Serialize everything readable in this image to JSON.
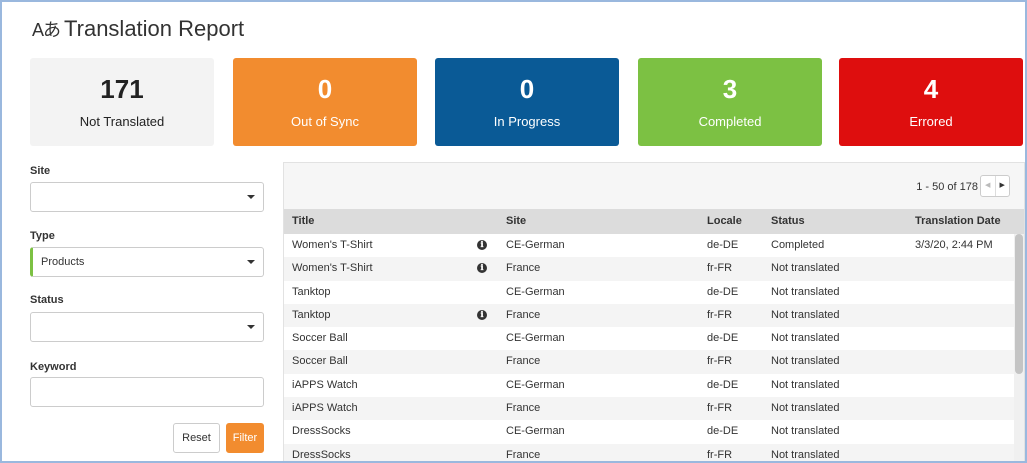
{
  "header": {
    "title": "Translation Report",
    "icon": "translate-icon"
  },
  "stats": [
    {
      "value": "171",
      "label": "Not Translated",
      "color": "#f3f3f3"
    },
    {
      "value": "0",
      "label": "Out of Sync",
      "color": "#f28c2f"
    },
    {
      "value": "0",
      "label": "In Progress",
      "color": "#0a5a96"
    },
    {
      "value": "3",
      "label": "Completed",
      "color": "#7cc143"
    },
    {
      "value": "4",
      "label": "Errored",
      "color": "#de0e0e"
    }
  ],
  "filters": {
    "site_label": "Site",
    "site_value": "",
    "type_label": "Type",
    "type_value": "Products",
    "status_label": "Status",
    "status_value": "",
    "keyword_label": "Keyword",
    "keyword_value": "",
    "reset_label": "Reset",
    "filter_label": "Filter"
  },
  "pager": {
    "text": "1 - 50 of 178"
  },
  "table": {
    "headers": {
      "title": "Title",
      "site": "Site",
      "locale": "Locale",
      "status": "Status",
      "date": "Translation Date"
    },
    "rows": [
      {
        "title": "Women's T-Shirt",
        "info": true,
        "site": "CE-German",
        "locale": "de-DE",
        "status": "Completed",
        "date": "3/3/20, 2:44 PM"
      },
      {
        "title": "Women's T-Shirt",
        "info": true,
        "site": "France",
        "locale": "fr-FR",
        "status": "Not translated",
        "date": ""
      },
      {
        "title": "Tanktop",
        "info": false,
        "site": "CE-German",
        "locale": "de-DE",
        "status": "Not translated",
        "date": ""
      },
      {
        "title": "Tanktop",
        "info": true,
        "site": "France",
        "locale": "fr-FR",
        "status": "Not translated",
        "date": ""
      },
      {
        "title": "Soccer Ball",
        "info": false,
        "site": "CE-German",
        "locale": "de-DE",
        "status": "Not translated",
        "date": ""
      },
      {
        "title": "Soccer Ball",
        "info": false,
        "site": "France",
        "locale": "fr-FR",
        "status": "Not translated",
        "date": ""
      },
      {
        "title": "iAPPS Watch",
        "info": false,
        "site": "CE-German",
        "locale": "de-DE",
        "status": "Not translated",
        "date": ""
      },
      {
        "title": "iAPPS Watch",
        "info": false,
        "site": "France",
        "locale": "fr-FR",
        "status": "Not translated",
        "date": ""
      },
      {
        "title": "DressSocks",
        "info": false,
        "site": "CE-German",
        "locale": "de-DE",
        "status": "Not translated",
        "date": ""
      },
      {
        "title": "DressSocks",
        "info": false,
        "site": "France",
        "locale": "fr-FR",
        "status": "Not translated",
        "date": ""
      }
    ]
  }
}
